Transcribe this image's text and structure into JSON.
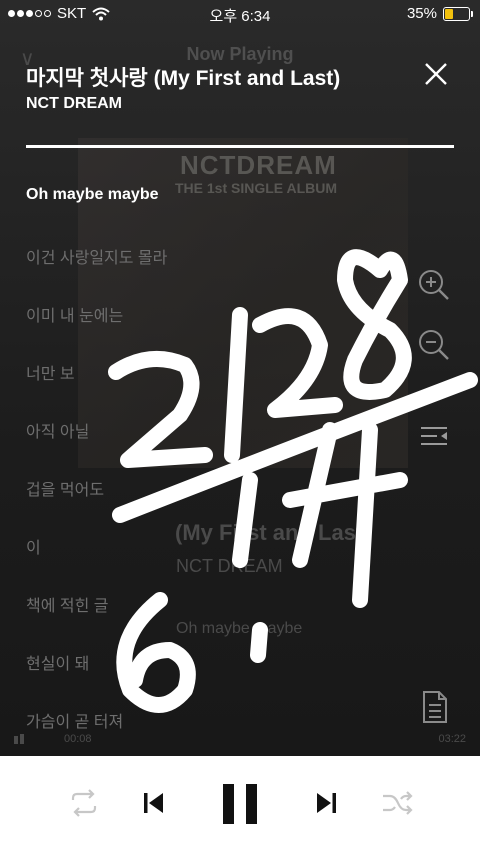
{
  "status_bar": {
    "carrier": "SKT",
    "time": "오후 6:34",
    "battery_percent": "35%",
    "battery_level": 0.35
  },
  "player": {
    "background_heading": "Now Playing",
    "song_title": "마지막 첫사랑 (My First and Last)",
    "artist": "NCT DREAM",
    "album_art_title": "NCTDREAM",
    "album_art_subtitle": "THE 1st SINGLE ALBUM",
    "elapsed": "00:08",
    "duration": "03:22",
    "background_lyric": "Oh maybe maybe"
  },
  "lyrics": [
    {
      "text": "Oh maybe maybe",
      "active": true
    },
    {
      "text": "이건 사랑일지도 몰라",
      "active": false
    },
    {
      "text": "이미 내 눈에는",
      "active": false
    },
    {
      "text": "너만 보",
      "active": false
    },
    {
      "text": "아직 아닐",
      "active": false
    },
    {
      "text": "겁을 먹어도",
      "active": false
    },
    {
      "text": "이",
      "active": false
    },
    {
      "text": "책에 적힌 글",
      "active": false
    },
    {
      "text": "현실이 돼",
      "active": false
    },
    {
      "text": "가슴이 곧 터져",
      "active": false
    }
  ],
  "icons": {
    "close": "close-icon",
    "zoom_in": "zoom-in-icon",
    "zoom_out": "zoom-out-icon",
    "lyrics_sync": "lyrics-sync-icon",
    "lyrics_doc": "document-icon",
    "repeat": "repeat-icon",
    "previous": "previous-icon",
    "pause": "pause-icon",
    "next": "next-icon",
    "shuffle": "shuffle-icon"
  },
  "colors": {
    "accent_battery": "#f2c10e",
    "lyric_active": "#ffffff",
    "lyric_inactive": "#6e6e6e",
    "controls_bg": "#ffffff"
  }
}
